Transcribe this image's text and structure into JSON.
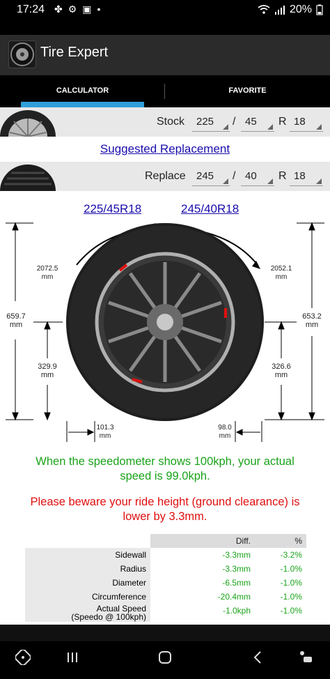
{
  "status_bar": {
    "time": "17:24",
    "battery": "20%",
    "notif_icons": [
      "fan-icon",
      "settings-icon",
      "image-icon",
      "dot"
    ]
  },
  "app_bar": {
    "title": "Tire Expert"
  },
  "tabs": [
    {
      "label": "CALCULATOR",
      "active": true
    },
    {
      "label": "FAVORITE",
      "active": false
    }
  ],
  "stock": {
    "label": "Stock",
    "width": "225",
    "slash": "/",
    "aspect": "45",
    "r_label": "R",
    "rim": "18"
  },
  "suggested_link": "Suggested Replacement",
  "replace": {
    "label": "Replace",
    "width": "245",
    "slash": "/",
    "aspect": "40",
    "r_label": "R",
    "rim": "18"
  },
  "diagram": {
    "stock_size": "225/45R18",
    "replace_size": "245/40R18",
    "left_circumference": "2072.5",
    "left_circumference_unit": "mm",
    "right_circumference": "2052.1",
    "right_circumference_unit": "mm",
    "left_diameter": "659.7",
    "left_diameter_unit": "mm",
    "right_diameter": "653.2",
    "right_diameter_unit": "mm",
    "left_radius": "329.9",
    "left_radius_unit": "mm",
    "right_radius": "326.6",
    "right_radius_unit": "mm",
    "left_sidewall": "101.3",
    "left_sidewall_unit": "mm",
    "right_sidewall": "98.0",
    "right_sidewall_unit": "mm"
  },
  "messages": {
    "speed_line1": "When the speedometer shows 100kph, your actual",
    "speed_line2": "speed is 99.0kph.",
    "ride_line1": "Please beware your ride height (ground clearance) is",
    "ride_line2": "lower by 3.3mm."
  },
  "table": {
    "headers": [
      "",
      "Diff.",
      "%"
    ],
    "rows": [
      {
        "label": "Sidewall",
        "diff": "-3.3mm",
        "pct": "-3.2%"
      },
      {
        "label": "Radius",
        "diff": "-3.3mm",
        "pct": "-1.0%"
      },
      {
        "label": "Diameter",
        "diff": "-6.5mm",
        "pct": "-1.0%"
      },
      {
        "label": "Circumference",
        "diff": "-20.4mm",
        "pct": "-1.0%"
      },
      {
        "label": "Actual Speed",
        "label2": "(Speedo @ 100kph)",
        "diff": "-1.0kph",
        "pct": "-1.0%"
      }
    ]
  },
  "colors": {
    "accent": "#2f9ed9",
    "link": "#1a0dab",
    "green": "#1aa31a",
    "red": "#e01010"
  },
  "nav": [
    "game-icon",
    "recents-icon",
    "home-icon",
    "back-icon",
    "accessibility-icon"
  ]
}
